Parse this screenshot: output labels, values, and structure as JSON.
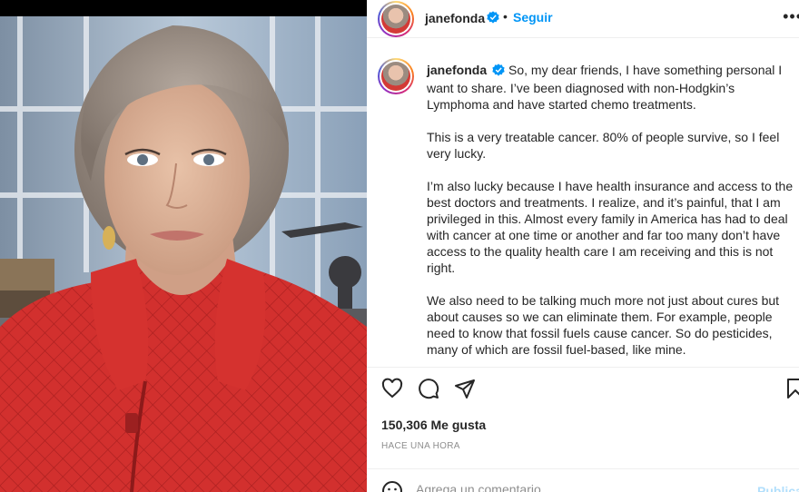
{
  "post": {
    "username": "janefonda",
    "follow_label": "Seguir",
    "separator": "•",
    "more_label": "•••"
  },
  "caption": {
    "username": "janefonda",
    "paragraphs": [
      "So, my dear friends, I have something personal I want to share. I’ve been diagnosed with non-Hodgkin’s Lymphoma and have started chemo treatments.",
      "This is a very treatable cancer. 80% of people survive, so I feel very lucky.",
      "I’m also lucky because I have health insurance and access to the best doctors and treatments. I realize, and it’s painful, that I am privileged in this. Almost every family in America has had to deal with cancer at one time or another and far too many don’t have access to the quality health care I am receiving and this is not right.",
      "We also need to be talking much more not just about cures but about causes so we can eliminate them. For example, people need to know that fossil fuels cause cancer. So do pesticides, many of which are fossil fuel-based, like mine."
    ]
  },
  "engagement": {
    "likes": "150,306 Me gusta",
    "time": "HACE UNA HORA"
  },
  "comment": {
    "placeholder": "Agrega un comentario...",
    "publish_label": "Publicar"
  },
  "icons": {
    "like": "heart-icon",
    "comment": "comment-icon",
    "share": "send-icon",
    "save": "bookmark-icon",
    "emoji": "emoji-icon",
    "verified": "verified-badge-icon"
  },
  "colors": {
    "link": "#0095f6",
    "verified": "#0095f6",
    "muted": "#8e8e8e",
    "publish_disabled": "#b2dffc"
  }
}
